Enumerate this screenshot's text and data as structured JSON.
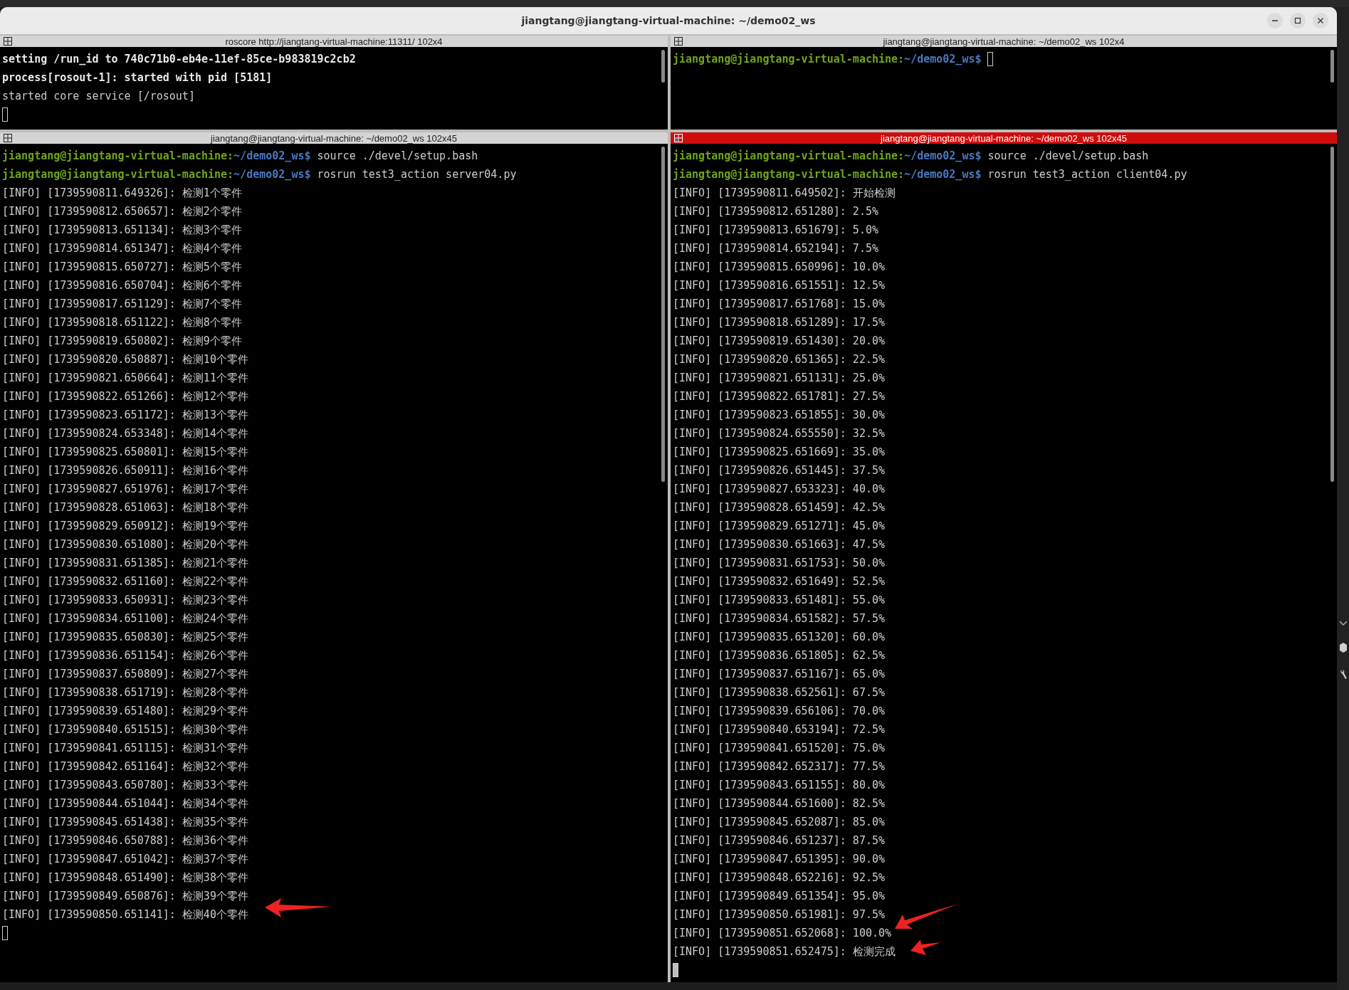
{
  "window": {
    "title": "jiangtang@jiangtang-virtual-machine: ~/demo02_ws"
  },
  "panes": [
    {
      "title": "roscore http://jiangtang-virtual-machine:11311/ 102x4",
      "focused": false,
      "lines": [
        {
          "kind": "bright",
          "text": "setting /run_id to 740c71b0-eb4e-11ef-85ce-b983819c2cb2"
        },
        {
          "kind": "bright",
          "text": "process[rosout-1]: started with pid [5181]"
        },
        {
          "kind": "text",
          "text": "started core service [/rosout]"
        }
      ]
    },
    {
      "title": "jiangtang@jiangtang-virtual-machine: ~/demo02_ws 102x4",
      "focused": false,
      "lines": [
        {
          "kind": "prompt",
          "user": "jiangtang@jiangtang-virtual-machine:",
          "path": "~/demo02_ws$"
        }
      ]
    },
    {
      "title": "jiangtang@jiangtang-virtual-machine: ~/demo02_ws 102x45",
      "focused": false,
      "lines": [
        {
          "kind": "prompt",
          "user": "jiangtang@jiangtang-virtual-machine:",
          "path": "~/demo02_ws$",
          "command": "source ./devel/setup.bash"
        },
        {
          "kind": "prompt",
          "user": "jiangtang@jiangtang-virtual-machine:",
          "path": "~/demo02_ws$",
          "command": "rosrun test3_action server04.py"
        },
        {
          "kind": "text",
          "text": "[INFO] [1739590811.649326]: 检测1个零件"
        },
        {
          "kind": "text",
          "text": "[INFO] [1739590812.650657]: 检测2个零件"
        },
        {
          "kind": "text",
          "text": "[INFO] [1739590813.651134]: 检测3个零件"
        },
        {
          "kind": "text",
          "text": "[INFO] [1739590814.651347]: 检测4个零件"
        },
        {
          "kind": "text",
          "text": "[INFO] [1739590815.650727]: 检测5个零件"
        },
        {
          "kind": "text",
          "text": "[INFO] [1739590816.650704]: 检测6个零件"
        },
        {
          "kind": "text",
          "text": "[INFO] [1739590817.651129]: 检测7个零件"
        },
        {
          "kind": "text",
          "text": "[INFO] [1739590818.651122]: 检测8个零件"
        },
        {
          "kind": "text",
          "text": "[INFO] [1739590819.650802]: 检测9个零件"
        },
        {
          "kind": "text",
          "text": "[INFO] [1739590820.650887]: 检测10个零件"
        },
        {
          "kind": "text",
          "text": "[INFO] [1739590821.650664]: 检测11个零件"
        },
        {
          "kind": "text",
          "text": "[INFO] [1739590822.651266]: 检测12个零件"
        },
        {
          "kind": "text",
          "text": "[INFO] [1739590823.651172]: 检测13个零件"
        },
        {
          "kind": "text",
          "text": "[INFO] [1739590824.653348]: 检测14个零件"
        },
        {
          "kind": "text",
          "text": "[INFO] [1739590825.650801]: 检测15个零件"
        },
        {
          "kind": "text",
          "text": "[INFO] [1739590826.650911]: 检测16个零件"
        },
        {
          "kind": "text",
          "text": "[INFO] [1739590827.651976]: 检测17个零件"
        },
        {
          "kind": "text",
          "text": "[INFO] [1739590828.651063]: 检测18个零件"
        },
        {
          "kind": "text",
          "text": "[INFO] [1739590829.650912]: 检测19个零件"
        },
        {
          "kind": "text",
          "text": "[INFO] [1739590830.651080]: 检测20个零件"
        },
        {
          "kind": "text",
          "text": "[INFO] [1739590831.651385]: 检测21个零件"
        },
        {
          "kind": "text",
          "text": "[INFO] [1739590832.651160]: 检测22个零件"
        },
        {
          "kind": "text",
          "text": "[INFO] [1739590833.650931]: 检测23个零件"
        },
        {
          "kind": "text",
          "text": "[INFO] [1739590834.651100]: 检测24个零件"
        },
        {
          "kind": "text",
          "text": "[INFO] [1739590835.650830]: 检测25个零件"
        },
        {
          "kind": "text",
          "text": "[INFO] [1739590836.651154]: 检测26个零件"
        },
        {
          "kind": "text",
          "text": "[INFO] [1739590837.650809]: 检测27个零件"
        },
        {
          "kind": "text",
          "text": "[INFO] [1739590838.651719]: 检测28个零件"
        },
        {
          "kind": "text",
          "text": "[INFO] [1739590839.651480]: 检测29个零件"
        },
        {
          "kind": "text",
          "text": "[INFO] [1739590840.651515]: 检测30个零件"
        },
        {
          "kind": "text",
          "text": "[INFO] [1739590841.651115]: 检测31个零件"
        },
        {
          "kind": "text",
          "text": "[INFO] [1739590842.651164]: 检测32个零件"
        },
        {
          "kind": "text",
          "text": "[INFO] [1739590843.650780]: 检测33个零件"
        },
        {
          "kind": "text",
          "text": "[INFO] [1739590844.651044]: 检测34个零件"
        },
        {
          "kind": "text",
          "text": "[INFO] [1739590845.651438]: 检测35个零件"
        },
        {
          "kind": "text",
          "text": "[INFO] [1739590846.650788]: 检测36个零件"
        },
        {
          "kind": "text",
          "text": "[INFO] [1739590847.651042]: 检测37个零件"
        },
        {
          "kind": "text",
          "text": "[INFO] [1739590848.651490]: 检测38个零件"
        },
        {
          "kind": "text",
          "text": "[INFO] [1739590849.650876]: 检测39个零件"
        },
        {
          "kind": "text",
          "text": "[INFO] [1739590850.651141]: 检测40个零件"
        }
      ]
    },
    {
      "title": "jiangtang@jiangtang-virtual-machine: ~/demo02_ws 102x45",
      "focused": true,
      "lines": [
        {
          "kind": "prompt",
          "user": "jiangtang@jiangtang-virtual-machine:",
          "path": "~/demo02_ws$",
          "command": "source ./devel/setup.bash"
        },
        {
          "kind": "prompt",
          "user": "jiangtang@jiangtang-virtual-machine:",
          "path": "~/demo02_ws$",
          "command": "rosrun test3_action client04.py"
        },
        {
          "kind": "text",
          "text": "[INFO] [1739590811.649502]: 开始检测"
        },
        {
          "kind": "text",
          "text": "[INFO] [1739590812.651280]: 2.5%"
        },
        {
          "kind": "text",
          "text": "[INFO] [1739590813.651679]: 5.0%"
        },
        {
          "kind": "text",
          "text": "[INFO] [1739590814.652194]: 7.5%"
        },
        {
          "kind": "text",
          "text": "[INFO] [1739590815.650996]: 10.0%"
        },
        {
          "kind": "text",
          "text": "[INFO] [1739590816.651551]: 12.5%"
        },
        {
          "kind": "text",
          "text": "[INFO] [1739590817.651768]: 15.0%"
        },
        {
          "kind": "text",
          "text": "[INFO] [1739590818.651289]: 17.5%"
        },
        {
          "kind": "text",
          "text": "[INFO] [1739590819.651430]: 20.0%"
        },
        {
          "kind": "text",
          "text": "[INFO] [1739590820.651365]: 22.5%"
        },
        {
          "kind": "text",
          "text": "[INFO] [1739590821.651131]: 25.0%"
        },
        {
          "kind": "text",
          "text": "[INFO] [1739590822.651781]: 27.5%"
        },
        {
          "kind": "text",
          "text": "[INFO] [1739590823.651855]: 30.0%"
        },
        {
          "kind": "text",
          "text": "[INFO] [1739590824.655550]: 32.5%"
        },
        {
          "kind": "text",
          "text": "[INFO] [1739590825.651669]: 35.0%"
        },
        {
          "kind": "text",
          "text": "[INFO] [1739590826.651445]: 37.5%"
        },
        {
          "kind": "text",
          "text": "[INFO] [1739590827.653323]: 40.0%"
        },
        {
          "kind": "text",
          "text": "[INFO] [1739590828.651459]: 42.5%"
        },
        {
          "kind": "text",
          "text": "[INFO] [1739590829.651271]: 45.0%"
        },
        {
          "kind": "text",
          "text": "[INFO] [1739590830.651663]: 47.5%"
        },
        {
          "kind": "text",
          "text": "[INFO] [1739590831.651753]: 50.0%"
        },
        {
          "kind": "text",
          "text": "[INFO] [1739590832.651649]: 52.5%"
        },
        {
          "kind": "text",
          "text": "[INFO] [1739590833.651481]: 55.0%"
        },
        {
          "kind": "text",
          "text": "[INFO] [1739590834.651582]: 57.5%"
        },
        {
          "kind": "text",
          "text": "[INFO] [1739590835.651320]: 60.0%"
        },
        {
          "kind": "text",
          "text": "[INFO] [1739590836.651805]: 62.5%"
        },
        {
          "kind": "text",
          "text": "[INFO] [1739590837.651167]: 65.0%"
        },
        {
          "kind": "text",
          "text": "[INFO] [1739590838.652561]: 67.5%"
        },
        {
          "kind": "text",
          "text": "[INFO] [1739590839.656106]: 70.0%"
        },
        {
          "kind": "text",
          "text": "[INFO] [1739590840.653194]: 72.5%"
        },
        {
          "kind": "text",
          "text": "[INFO] [1739590841.651520]: 75.0%"
        },
        {
          "kind": "text",
          "text": "[INFO] [1739590842.652317]: 77.5%"
        },
        {
          "kind": "text",
          "text": "[INFO] [1739590843.651155]: 80.0%"
        },
        {
          "kind": "text",
          "text": "[INFO] [1739590844.651600]: 82.5%"
        },
        {
          "kind": "text",
          "text": "[INFO] [1739590845.652087]: 85.0%"
        },
        {
          "kind": "text",
          "text": "[INFO] [1739590846.651237]: 87.5%"
        },
        {
          "kind": "text",
          "text": "[INFO] [1739590847.651395]: 90.0%"
        },
        {
          "kind": "text",
          "text": "[INFO] [1739590848.652216]: 92.5%"
        },
        {
          "kind": "text",
          "text": "[INFO] [1739590849.651354]: 95.0%"
        },
        {
          "kind": "text",
          "text": "[INFO] [1739590850.651981]: 97.5%"
        },
        {
          "kind": "text",
          "text": "[INFO] [1739590851.652068]: 100.0%"
        },
        {
          "kind": "text",
          "text": "[INFO] [1739590851.652475]: 检测完成"
        }
      ]
    }
  ]
}
